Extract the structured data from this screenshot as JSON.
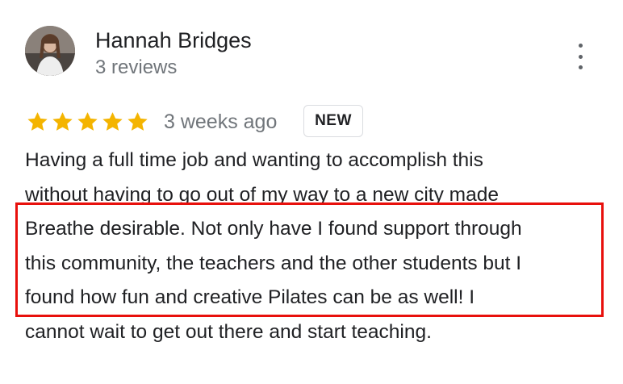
{
  "reviewer": {
    "name": "Hannah Bridges",
    "review_count": "3 reviews"
  },
  "review": {
    "rating": 5,
    "rating_max": 5,
    "date": "3 weeks ago",
    "badge": "NEW",
    "text_lines": [
      "Having a full time job and wanting to accomplish this",
      "without having to go out of my way to a new city made",
      "Breathe desirable. Not only have I found support through",
      "this community, the teachers and the other students but I",
      "found how fun and creative Pilates can be as well! I",
      "cannot wait to get out there and start teaching."
    ]
  },
  "icons": {
    "more": "more-vert-icon",
    "star": "star-icon"
  },
  "colors": {
    "star": "#f4b400",
    "highlight_border": "#e8100c",
    "secondary_text": "#70757a",
    "primary_text": "#202124"
  }
}
